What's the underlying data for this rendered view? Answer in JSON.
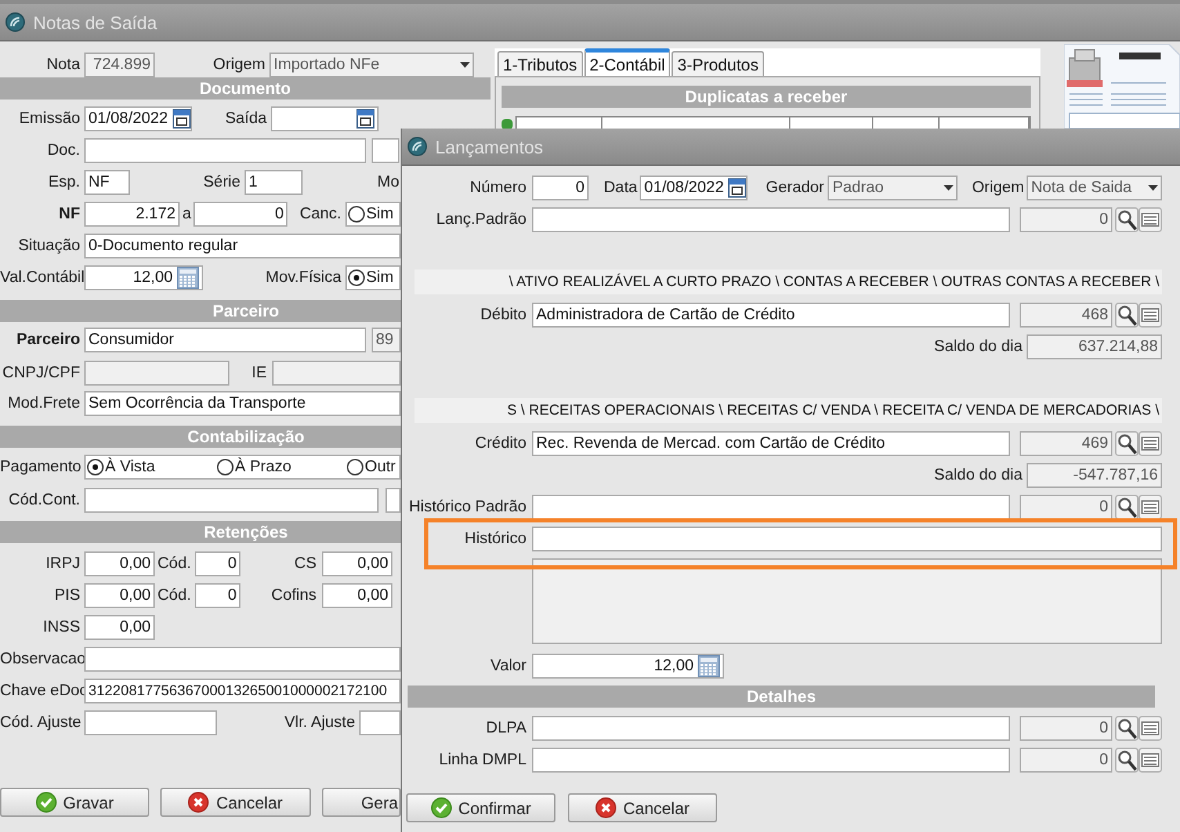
{
  "notas": {
    "title": "Notas de Saída",
    "nota": {
      "label": "Nota",
      "value": "724.899"
    },
    "origem": {
      "label": "Origem",
      "value": "Importado NFe"
    },
    "documento": {
      "heading": "Documento",
      "emissao": {
        "label": "Emissão",
        "value": "01/08/2022"
      },
      "saida": {
        "label": "Saída"
      },
      "doc": {
        "label": "Doc."
      },
      "esp": {
        "label": "Esp.",
        "value": "NF"
      },
      "serie": {
        "label": "Série",
        "value": "1"
      },
      "label_3": "Mo",
      "nf": {
        "label": "NF",
        "value": "2.172"
      },
      "nf_ate": {
        "label": "a",
        "value": "0"
      },
      "canc": {
        "label": "Canc.",
        "option": "Sim",
        "selected": false
      },
      "situacao": {
        "label": "Situação",
        "value": "0-Documento regular"
      },
      "val_contabil": {
        "label": "Val.Contábil",
        "value": "12,00"
      },
      "mov_fisica": {
        "label": "Mov.Física",
        "option": "Sim",
        "selected": true
      }
    },
    "parceiro": {
      "heading": "Parceiro",
      "parceiro": {
        "label": "Parceiro",
        "value": "Consumidor",
        "code": "89"
      },
      "cnpj": {
        "label": "CNPJ/CPF"
      },
      "ie": {
        "label": "IE"
      },
      "mod_frete": {
        "label": "Mod.Frete",
        "value": "Sem Ocorrência da Transporte"
      }
    },
    "contabilizacao": {
      "heading": "Contabilização",
      "pagamento": {
        "label": "Pagamento",
        "options": [
          {
            "label": "À Vista",
            "selected": true
          },
          {
            "label": "À Prazo",
            "selected": false
          },
          {
            "label": "Outr",
            "selected": false
          }
        ]
      },
      "cod_cont": {
        "label": "Cód.Cont."
      }
    },
    "retencoes": {
      "heading": "Retenções",
      "rows": [
        {
          "label": "IRPJ",
          "value": "0,00",
          "cod_label": "Cód.",
          "cod": "0",
          "other_label": "CS",
          "other": "0,00"
        },
        {
          "label": "PIS",
          "value": "0,00",
          "cod_label": "Cód.",
          "cod": "0",
          "other_label": "Cofins",
          "other": "0,00"
        },
        {
          "label": "INSS",
          "value": "0,00"
        }
      ],
      "observacao": {
        "label": "Observacao"
      },
      "chave": {
        "label": "Chave eDoc",
        "value": "3122081775636700013265001000002172100"
      },
      "cod_ajuste": {
        "label": "Cód. Ajuste"
      },
      "vlr_ajuste": {
        "label": "Vlr. Ajuste"
      }
    },
    "buttons": [
      {
        "label": "Gravar",
        "kind": "confirm"
      },
      {
        "label": "Cancelar",
        "kind": "cancel"
      },
      {
        "label": "Gera",
        "kind": "plain"
      }
    ],
    "tabs": [
      {
        "label": "1-Tributos",
        "selected": false
      },
      {
        "label": "2-Contábil",
        "selected": true
      },
      {
        "label": "3-Produtos",
        "selected": false
      }
    ],
    "duplicatas_heading": "Duplicatas a receber"
  },
  "lancamentos": {
    "title": "Lançamentos",
    "numero": {
      "label": "Número",
      "value": "0"
    },
    "data": {
      "label": "Data",
      "value": "01/08/2022"
    },
    "gerador": {
      "label": "Gerador",
      "value": "Padrao"
    },
    "origem": {
      "label": "Origem",
      "value": "Nota de Saida"
    },
    "lanc_padrao": {
      "label": "Lanç.Padrão",
      "code": "0"
    },
    "accounts": [
      {
        "path": "\\ ATIVO REALIZÁVEL A CURTO PRAZO \\ CONTAS A RECEBER \\ OUTRAS CONTAS A RECEBER \\",
        "label": "Débito",
        "value": "Administradora de Cartão de Crédito",
        "code": "468",
        "balance_label": "Saldo do dia",
        "balance": "637.214,88"
      },
      {
        "path": "S \\ RECEITAS OPERACIONAIS \\ RECEITAS C/ VENDA \\ RECEITA C/ VENDA DE MERCADORIAS \\",
        "label": "Crédito",
        "value": "Rec. Revenda de Mercad. com Cartão de Crédito",
        "code": "469",
        "balance_label": "Saldo do dia",
        "balance": "-547.787,16"
      }
    ],
    "historico_padrao": {
      "label": "Histórico Padrão",
      "code": "0"
    },
    "historico": {
      "label": "Histórico",
      "highlighted": true
    },
    "valor": {
      "label": "Valor",
      "value": "12,00"
    },
    "detalhes": {
      "heading": "Detalhes",
      "rows": [
        {
          "label": "DLPA",
          "code": "0"
        },
        {
          "label": "Linha DMPL",
          "code": "0"
        }
      ]
    },
    "buttons": [
      {
        "label": "Confirmar",
        "kind": "confirm"
      },
      {
        "label": "Cancelar",
        "kind": "cancel"
      }
    ]
  }
}
